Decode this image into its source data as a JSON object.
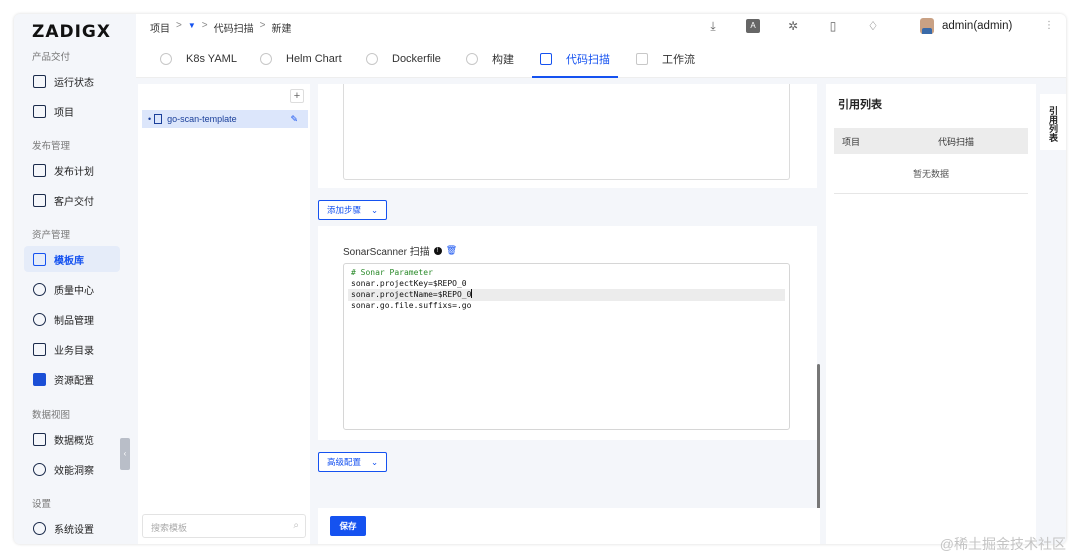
{
  "brand": {
    "logo_text": "ZADIGX"
  },
  "sidebar": {
    "groups": [
      {
        "label": "产品交付",
        "items": [
          {
            "label": "运行状态",
            "icon": "pulse-icon"
          },
          {
            "label": "项目",
            "icon": "project-icon"
          }
        ]
      },
      {
        "label": "发布管理",
        "items": [
          {
            "label": "发布计划",
            "icon": "plan-icon"
          },
          {
            "label": "客户交付",
            "icon": "delivery-icon"
          }
        ]
      },
      {
        "label": "资产管理",
        "items": [
          {
            "label": "模板库",
            "icon": "template-icon",
            "active": true
          },
          {
            "label": "质量中心",
            "icon": "flask-icon"
          },
          {
            "label": "制品管理",
            "icon": "artifact-icon"
          },
          {
            "label": "业务目录",
            "icon": "catalog-icon"
          },
          {
            "label": "资源配置",
            "icon": "gear-icon"
          }
        ]
      },
      {
        "label": "数据视图",
        "items": [
          {
            "label": "数据概览",
            "icon": "chart-icon"
          },
          {
            "label": "效能洞察",
            "icon": "pie-icon"
          }
        ]
      },
      {
        "label": "设置",
        "items": [
          {
            "label": "系统设置",
            "icon": "settings-icon"
          }
        ]
      }
    ],
    "collapse_label": "‹"
  },
  "breadcrumb": {
    "root": "项目",
    "sep": ">",
    "current_section": "代码扫描",
    "page": "新建"
  },
  "user": {
    "name": "admin(admin)"
  },
  "tabs": [
    {
      "label": "K8s YAML",
      "icon": "k8s-icon"
    },
    {
      "label": "Helm Chart",
      "icon": "helm-icon"
    },
    {
      "label": "Dockerfile",
      "icon": "docker-icon"
    },
    {
      "label": "构建",
      "icon": "build-icon"
    },
    {
      "label": "代码扫描",
      "icon": "scan-icon",
      "active": true
    },
    {
      "label": "工作流",
      "icon": "workflow-icon"
    }
  ],
  "templates": {
    "items": [
      {
        "name": "go-scan-template"
      }
    ],
    "search_placeholder": "搜索模板",
    "add_label": "+"
  },
  "editor": {
    "add_step_label": "添加步骤",
    "step_title": "SonarScanner 扫描",
    "code_lines": [
      "# Sonar Parameter",
      "sonar.projectKey=$REPO_0",
      "sonar.projectName=$REPO_0",
      "sonar.go.file.suffixs=.go"
    ],
    "advanced_label": "高级配置",
    "save_label": "保存"
  },
  "references": {
    "title": "引用列表",
    "columns": [
      "项目",
      "代码扫描"
    ],
    "empty_text": "暂无数据",
    "side_tab_label": "引用列表"
  },
  "watermark": "@稀土掘金技术社区",
  "colors": {
    "accent": "#1552f0",
    "active_bg": "#dce6fb",
    "page_bg": "#f4f6fa"
  }
}
